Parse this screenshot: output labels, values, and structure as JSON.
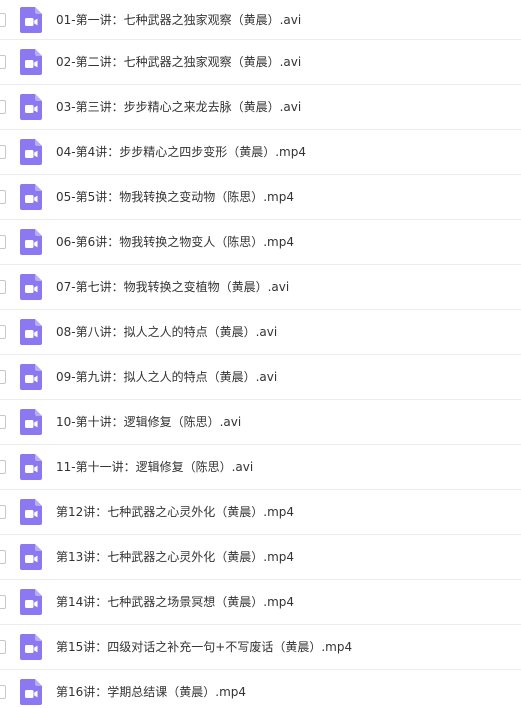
{
  "files": [
    {
      "name": "01-第一讲：七种武器之独家观察（黄晨）.avi",
      "icon": "video-file-icon"
    },
    {
      "name": "02-第二讲：七种武器之独家观察（黄晨）.avi",
      "icon": "video-file-icon"
    },
    {
      "name": "03-第三讲：步步精心之来龙去脉（黄晨）.avi",
      "icon": "video-file-icon"
    },
    {
      "name": "04-第4讲：步步精心之四步变形（黄晨）.mp4",
      "icon": "video-file-icon"
    },
    {
      "name": "05-第5讲：物我转换之变动物（陈思）.mp4",
      "icon": "video-file-icon"
    },
    {
      "name": "06-第6讲：物我转换之物变人（陈思）.mp4",
      "icon": "video-file-icon"
    },
    {
      "name": "07-第七讲：物我转换之变植物（黄晨）.avi",
      "icon": "video-file-icon"
    },
    {
      "name": "08-第八讲：拟人之人的特点（黄晨）.avi",
      "icon": "video-file-icon"
    },
    {
      "name": "09-第九讲：拟人之人的特点（黄晨）.avi",
      "icon": "video-file-icon"
    },
    {
      "name": "10-第十讲：逻辑修复（陈思）.avi",
      "icon": "video-file-icon"
    },
    {
      "name": "11-第十一讲：逻辑修复（陈思）.avi",
      "icon": "video-file-icon"
    },
    {
      "name": "第12讲：七种武器之心灵外化（黄晨）.mp4",
      "icon": "video-file-icon"
    },
    {
      "name": "第13讲：七种武器之心灵外化（黄晨）.mp4",
      "icon": "video-file-icon"
    },
    {
      "name": "第14讲：七种武器之场景冥想（黄晨）.mp4",
      "icon": "video-file-icon"
    },
    {
      "name": "第15讲：四级对话之补充一句+不写废话（黄晨）.mp4",
      "icon": "video-file-icon"
    },
    {
      "name": "第16讲：学期总结课（黄晨）.mp4",
      "icon": "video-file-icon"
    }
  ],
  "colors": {
    "icon_bg": "#8c78f0",
    "icon_fold": "#b8acf7",
    "text": "#333333",
    "divider": "#ececec"
  }
}
